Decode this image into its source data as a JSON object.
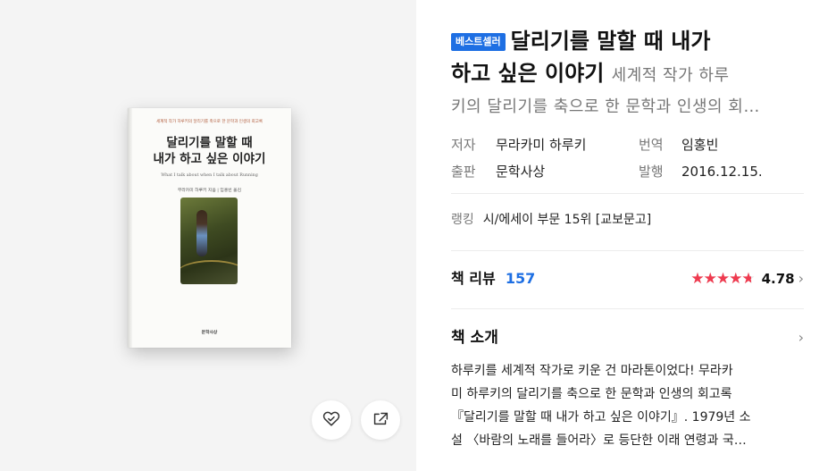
{
  "book": {
    "badge": "베스트셀러",
    "title_line1": "달리기를 말할 때 내가",
    "title_line2": "하고 싶은 이야기",
    "subtitle_part1": "세계적 작가 하루",
    "subtitle_part2": "키의 달리기를 축으로 한 문학과 인생의 회…"
  },
  "cover": {
    "tagline": "세계적 작가 하루키의 달리기를 축으로 한 문학과 인생의 회고록",
    "title_line1": "달리기를 말할 때",
    "title_line2": "내가 하고 싶은 이야기",
    "english_title": "What I talk about when I talk about Running",
    "credit": "무라카미 하루키 지음 | 임홍빈 옮김",
    "publisher": "문학사상"
  },
  "meta": {
    "author_label": "저자",
    "author": "무라카미 하루키",
    "translator_label": "번역",
    "translator": "임홍빈",
    "publisher_label": "출판",
    "publisher": "문학사상",
    "date_label": "발행",
    "date": "2016.12.15."
  },
  "ranking": {
    "label": "랭킹",
    "value": "시/에세이 부문 15위 [교보문고]"
  },
  "review": {
    "label": "책 리뷰",
    "count": "157",
    "rating": "4.78",
    "rating_fraction": 0.956,
    "stars_text": "★★★★★",
    "star_color": "#ef3a4f"
  },
  "intro": {
    "title": "책 소개",
    "lines": [
      "하루키를 세계적 작가로 키운 건 마라톤이었다! 무라카",
      "미 하루키의 달리기를 축으로 한 문학과 인생의 회고록",
      "『달리기를 말할 때 내가 하고 싶은 이야기』. 1979년 소",
      "설 〈바람의 노래를 들어라〉로 등단한 이래 연령과 국…"
    ]
  },
  "colors": {
    "accent": "#1e6fe3",
    "star": "#ef3a4f"
  },
  "icons": {
    "wishlist": "heart-check-icon",
    "share": "share-icon",
    "chevron": "chevron-right-icon"
  }
}
